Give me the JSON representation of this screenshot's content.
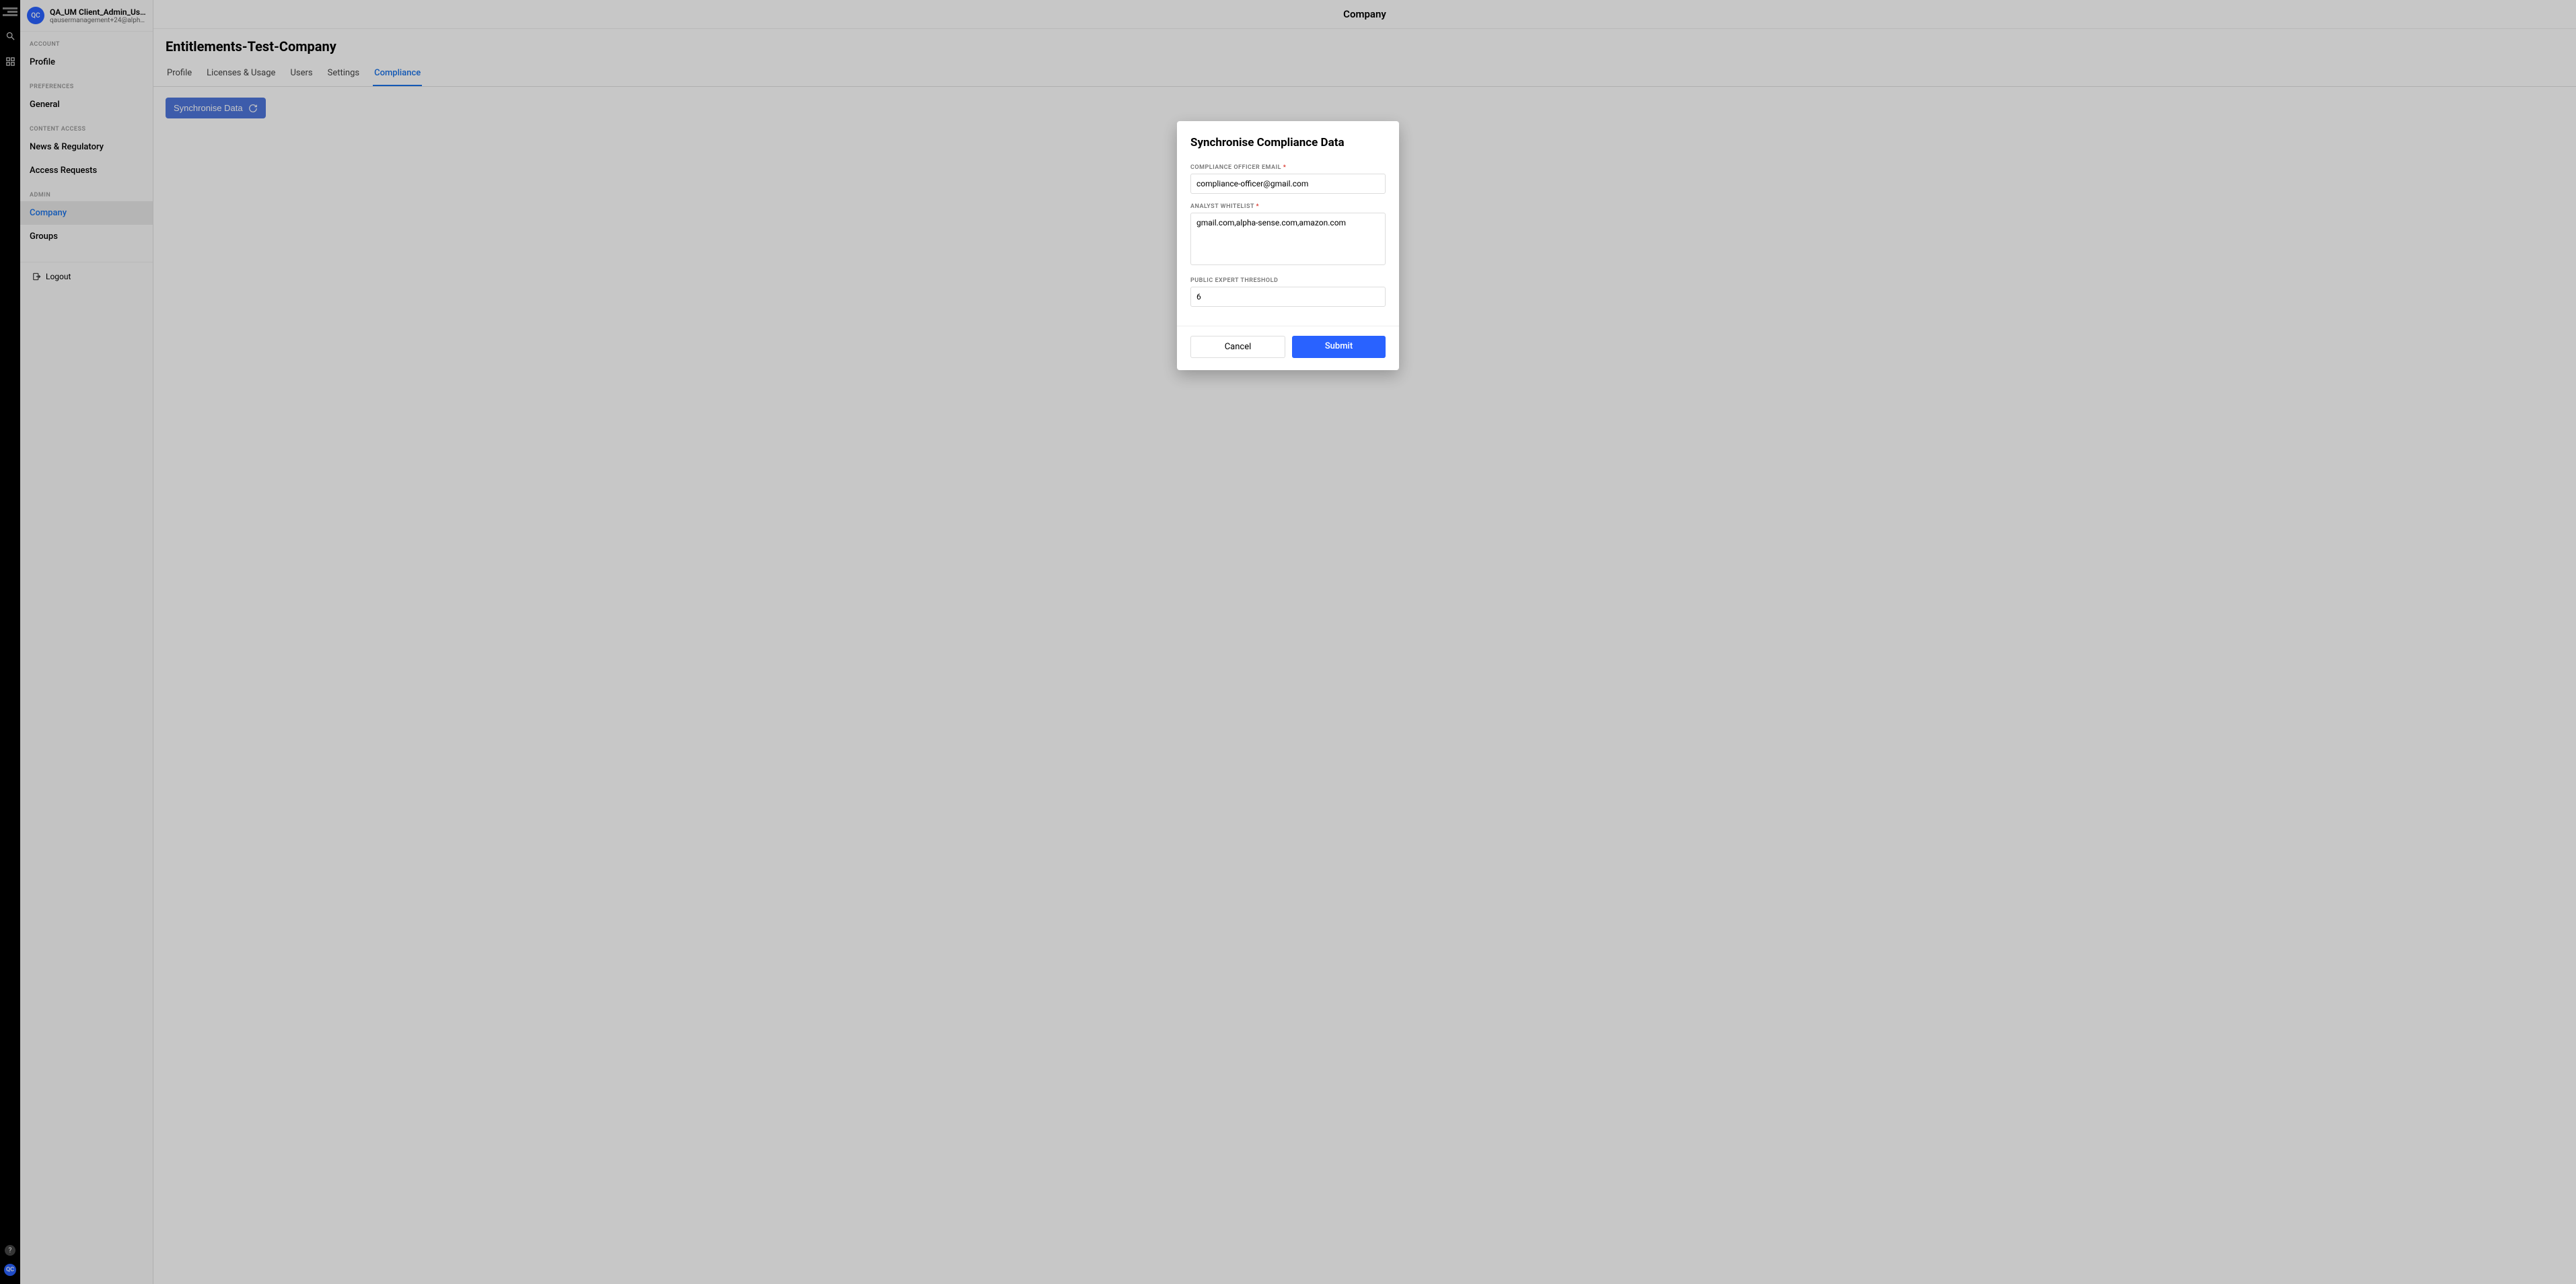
{
  "rail": {
    "avatar_initials": "QC"
  },
  "user": {
    "avatar_initials": "QC",
    "name": "QA_UM Client_Admin_User",
    "email": "qausermanagement+24@alpha-sense..."
  },
  "nav": {
    "account_label": "ACCOUNT",
    "profile": "Profile",
    "preferences_label": "PREFERENCES",
    "general": "General",
    "content_access_label": "CONTENT ACCESS",
    "news_regulatory": "News & Regulatory",
    "access_requests": "Access Requests",
    "admin_label": "ADMIN",
    "company": "Company",
    "groups": "Groups",
    "logout": "Logout"
  },
  "main": {
    "top_title": "Company",
    "page_title": "Entitlements-Test-Company",
    "tabs": {
      "profile": "Profile",
      "licenses": "Licenses & Usage",
      "users": "Users",
      "settings": "Settings",
      "compliance": "Compliance"
    },
    "sync_button": "Synchronise Data"
  },
  "modal": {
    "title": "Synchronise Compliance Data",
    "email_label": "COMPLIANCE OFFICER EMAIL",
    "email_value": "compliance-officer@gmail.com",
    "whitelist_label": "ANALYST WHITELIST",
    "whitelist_value": "gmail.com,alpha-sense.com,amazon.com",
    "threshold_label": "PUBLIC EXPERT THRESHOLD",
    "threshold_value": "6",
    "cancel": "Cancel",
    "submit": "Submit"
  }
}
